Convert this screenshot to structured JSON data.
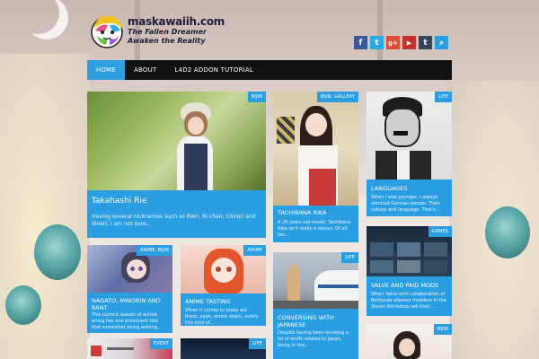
{
  "site": {
    "name": "maskawaiih.com",
    "tagline_line1": "The Fallen Dreamer",
    "tagline_line2": "Awaken the Reality"
  },
  "social_icons": [
    {
      "name": "facebook-icon",
      "glyph": "f",
      "color": "#3b5998"
    },
    {
      "name": "twitter-icon",
      "glyph": "t",
      "color": "#29a9e1"
    },
    {
      "name": "google-plus-icon",
      "glyph": "g+",
      "color": "#dd4b39"
    },
    {
      "name": "youtube-icon",
      "glyph": "▶",
      "color": "#c4302b"
    },
    {
      "name": "tumblr-icon",
      "glyph": "t",
      "color": "#35465c"
    },
    {
      "name": "search-icon",
      "glyph": "⌕",
      "color": "#2b9ee2"
    }
  ],
  "nav": {
    "items": [
      {
        "label": "HOME",
        "active": true
      },
      {
        "label": "ABOUT",
        "active": false
      },
      {
        "label": "L4D2 ADDON TUTORIAL",
        "active": false
      }
    ]
  },
  "posts": {
    "takahashi": {
      "tag": "BIJIN",
      "title": "Takahashi Rie",
      "excerpt": "Having several nicknames such as Rieri, Ri-chan, Chirori and Shieri, I am not sure..."
    },
    "tachibana": {
      "tag": "BIJIN, GALLERY",
      "title": "TACHIBANA RIKA",
      "excerpt": "A 26 years old model, Tachibana Rika isn't really a seiyuu. Of all, her..."
    },
    "languages": {
      "tag": "LIFE",
      "title": "LANGUAGES",
      "excerpt": "When I was younger, I always admired German people. Their culture and language. That's..."
    },
    "nagato": {
      "tag": "ANIME, BIJIN",
      "title": "NAGATO, MINORIN AND RANT",
      "excerpt": "This current season of anime airing has one prominent title that somewhat being waiting..."
    },
    "anime_tasting": {
      "tag": "ANIME",
      "title": "ANIME TASTING",
      "excerpt": "When it comes to otaku out there, yeah, anime otaku, surely this kind of..."
    },
    "conversing": {
      "tag": "LIFE",
      "title": "CONVERSING WITH JAPANESE",
      "excerpt": "Despite having been knowing a lot of stuffs related to Japan, being in the..."
    },
    "valve": {
      "tag": "GAMES",
      "title": "VALVE AND PAID MODS",
      "excerpt": "When Valve with collaboration of Bethesda allowed modders in the Steam Workshop sell their..."
    },
    "event": {
      "tag": "EVENT"
    },
    "life_bottom": {
      "tag": "LIFE"
    },
    "bijin_bottom": {
      "tag": "BIJIN"
    }
  },
  "colors": {
    "accent": "#2b9ee2",
    "nav_bg": "#111111"
  }
}
